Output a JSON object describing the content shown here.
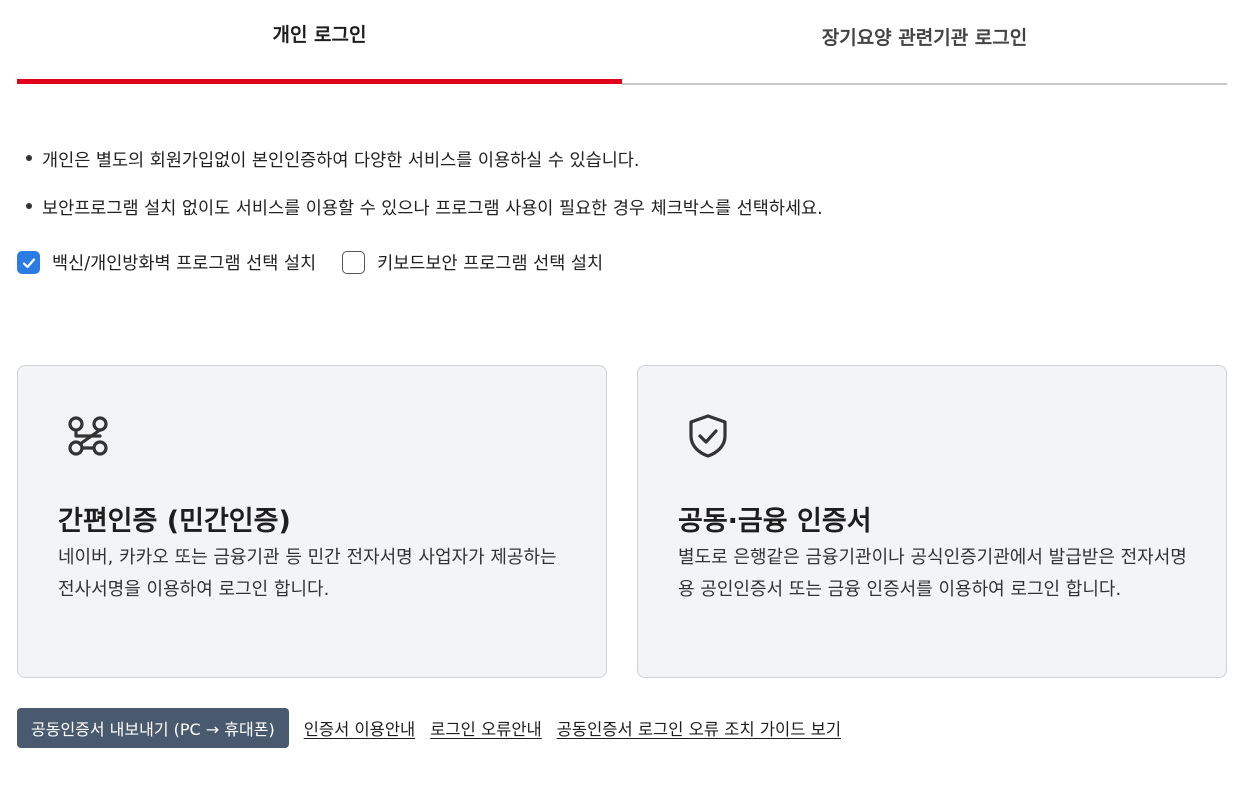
{
  "tabs": [
    {
      "label": "개인 로그인",
      "active": true
    },
    {
      "label": "장기요양 관련기관 로그인",
      "active": false
    }
  ],
  "notices": [
    "개인은 별도의 회원가입없이 본인인증하여 다양한 서비스를 이용하실 수 있습니다.",
    "보안프로그램 설치 없이도 서비스를 이용할 수 있으나 프로그램 사용이 필요한 경우 체크박스를 선택하세요."
  ],
  "checkboxes": [
    {
      "label": "백신/개인방화벽 프로그램 선택 설치",
      "checked": true
    },
    {
      "label": "키보드보안 프로그램 선택 설치",
      "checked": false
    }
  ],
  "cards": [
    {
      "icon": "command-icon",
      "title": "간편인증 (민간인증)",
      "description": "네이버, 카카오 또는 금융기관 등 민간 전자서명 사업자가 제공하는 전사서명을 이용하여 로그인 합니다."
    },
    {
      "icon": "shield-check-icon",
      "title": "공동·금융 인증서",
      "description": "별도로 은행같은 금융기관이나 공식인증기관에서 발급받은 전자서명용 공인인증서 또는 금융 인증서를 이용하여 로그인 합니다."
    }
  ],
  "footer": {
    "export_button": "공동인증서 내보내기 (PC → 휴대폰)",
    "links": [
      "인증서 이용안내",
      "로그인 오류안내",
      "공동인증서 로그인 오류 조치 가이드 보기"
    ]
  },
  "colors": {
    "accent": "#e0001b",
    "checkbox": "#2b7be5",
    "button": "#4a5a6e",
    "card_bg": "#f3f4f6"
  }
}
